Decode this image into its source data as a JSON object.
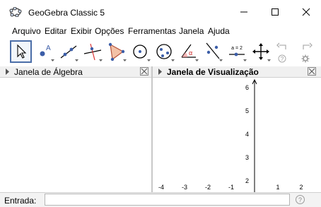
{
  "window": {
    "title": "GeoGebra Classic 5",
    "controls": [
      "minimize-icon",
      "maximize-icon",
      "close-icon"
    ]
  },
  "menu": [
    "Arquivo",
    "Editar",
    "Exibir",
    "Opções",
    "Ferramentas",
    "Janela",
    "Ajuda"
  ],
  "toolbar": {
    "tools": [
      {
        "name": "move-tool",
        "icon": "arrow-pointer-icon"
      },
      {
        "name": "point-tool",
        "icon": "point-icon",
        "label": "A"
      },
      {
        "name": "line-tool",
        "icon": "line-icon"
      },
      {
        "name": "perpendicular-line-tool",
        "icon": "perpendicular-icon"
      },
      {
        "name": "polygon-tool",
        "icon": "polygon-icon"
      },
      {
        "name": "circle-tool",
        "icon": "circle-icon"
      },
      {
        "name": "circle-three-points-tool",
        "icon": "circle-points-icon"
      },
      {
        "name": "angle-tool",
        "icon": "angle-icon",
        "label": "α"
      },
      {
        "name": "reflect-tool",
        "icon": "reflect-icon"
      },
      {
        "name": "slider-tool",
        "icon": "slider-icon",
        "label": "a = 2"
      },
      {
        "name": "move-graphics-tool",
        "icon": "move-view-icon"
      }
    ],
    "undo_icon": "undo-icon",
    "redo_icon": "redo-icon",
    "help_icon": "help-icon",
    "settings_icon": "settings-icon"
  },
  "algebra_panel": {
    "title": "Janela de Álgebra"
  },
  "graphics_panel": {
    "title": "Janela de Visualização",
    "x_ticks": [
      "-4",
      "-3",
      "-2",
      "-1",
      "1",
      "2"
    ],
    "y_ticks": [
      "2",
      "3",
      "4",
      "5",
      "6"
    ]
  },
  "input": {
    "label": "Entrada:",
    "value": "",
    "help": "?"
  },
  "colors": {
    "selected_tool_border": "#4b6ea8",
    "panel_header": "#f0f0f0",
    "input_bar": "#f3f3f3"
  }
}
